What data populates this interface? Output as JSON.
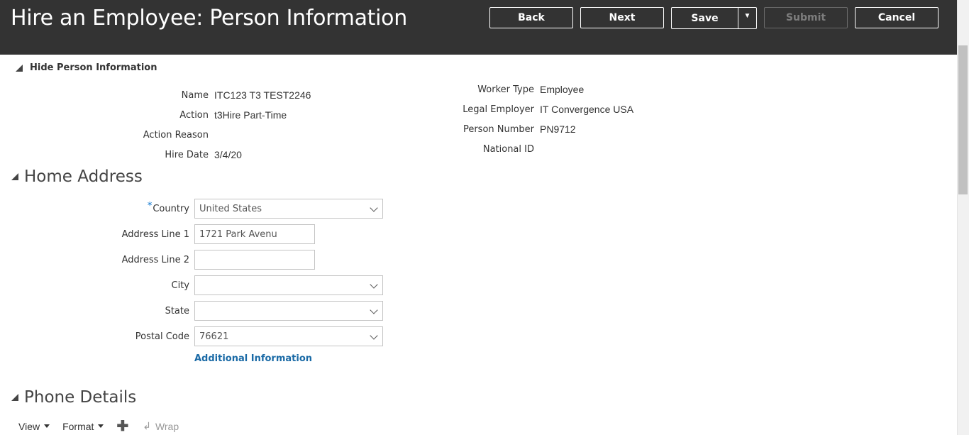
{
  "header": {
    "title": "Hire an Employee: Person Information",
    "buttons": {
      "back": "Back",
      "next": "Next",
      "save": "Save",
      "submit": "Submit",
      "cancel": "Cancel"
    }
  },
  "person_info": {
    "toggle_label": "Hide Person Information",
    "left": [
      {
        "label": "Name",
        "value": "ITC123 T3 TEST2246"
      },
      {
        "label": "Action",
        "value": "t3Hire Part-Time"
      },
      {
        "label": "Action Reason",
        "value": ""
      },
      {
        "label": "Hire Date",
        "value": "3/4/20"
      }
    ],
    "right": [
      {
        "label": "Worker Type",
        "value": "Employee"
      },
      {
        "label": "Legal Employer",
        "value": "IT Convergence USA"
      },
      {
        "label": "Person Number",
        "value": "PN9712"
      },
      {
        "label": "National ID",
        "value": ""
      }
    ]
  },
  "home_address": {
    "heading": "Home Address",
    "required_mark": "*",
    "country": {
      "label": "Country",
      "value": "United States"
    },
    "address_line_1": {
      "label": "Address Line 1",
      "value": "1721 Park Avenu"
    },
    "address_line_2": {
      "label": "Address Line 2",
      "value": ""
    },
    "city": {
      "label": "City",
      "value": ""
    },
    "state": {
      "label": "State",
      "value": ""
    },
    "postal_code": {
      "label": "Postal Code",
      "value": "76621"
    },
    "additional_info_link": "Additional Information"
  },
  "phone_details": {
    "heading": "Phone Details",
    "toolbar": {
      "view": "View",
      "format": "Format",
      "add_icon": "plus-icon",
      "wrap": "Wrap"
    }
  }
}
